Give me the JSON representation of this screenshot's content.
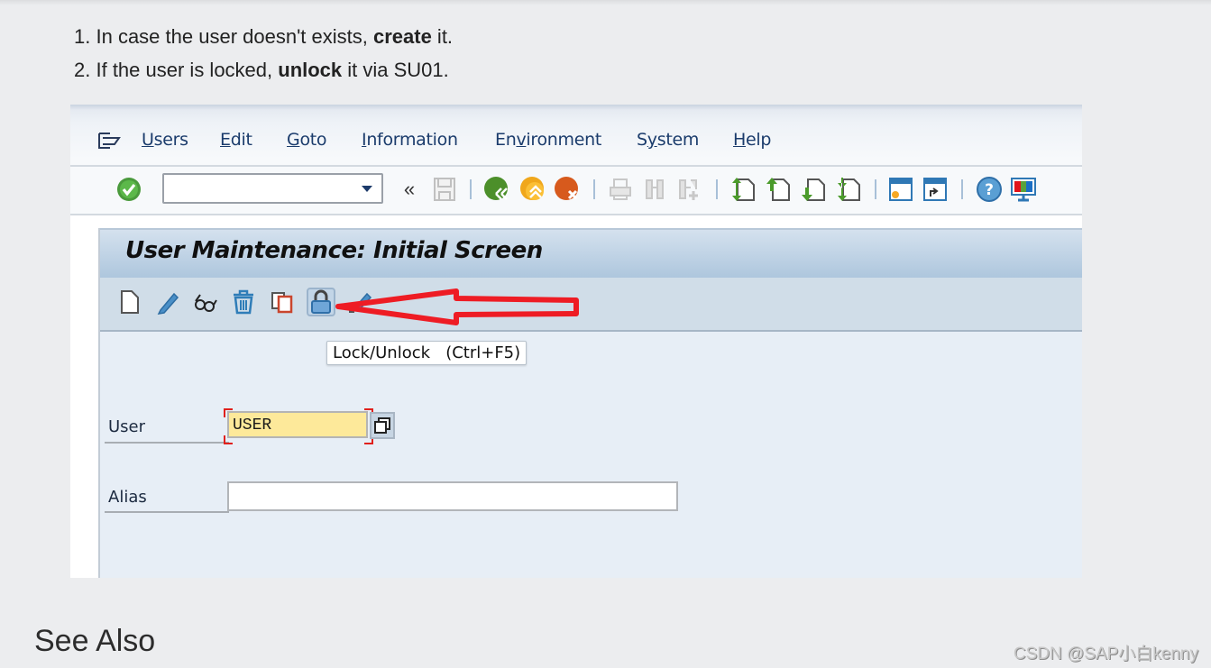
{
  "instructions": {
    "steps": [
      {
        "number": "1.",
        "before": "In case the user doesn't exists, ",
        "bold": "create",
        "after": " it."
      },
      {
        "number": "2.",
        "before": "If the user is locked, ",
        "bold": "unlock",
        "after": " it via SU01."
      }
    ]
  },
  "sap": {
    "menubar": {
      "items": [
        {
          "mnemonic": "U",
          "rest": "sers"
        },
        {
          "mnemonic": "E",
          "rest": "dit"
        },
        {
          "mnemonic": "G",
          "rest": "oto"
        },
        {
          "mnemonic": "I",
          "rest": "nformation"
        },
        {
          "pre": "En",
          "mnemonic": "v",
          "rest": "ironment"
        },
        {
          "pre": "S",
          "mnemonic": "y",
          "rest": "stem"
        },
        {
          "mnemonic": "H",
          "rest": "elp"
        }
      ]
    },
    "toolbar": {
      "command_field_value": "",
      "icons": [
        "enter-icon",
        "collapse-icon",
        "save-icon",
        "back-icon",
        "exit-icon",
        "cancel-icon",
        "print-icon",
        "find-icon",
        "find-next-icon",
        "first-page-icon",
        "previous-page-icon",
        "next-page-icon",
        "last-page-icon",
        "create-session-icon",
        "shortcut-icon",
        "help-icon",
        "layout-menu-icon"
      ]
    },
    "screen_title": "User Maintenance: Initial Screen",
    "app_toolbar": {
      "icons": [
        "create-icon",
        "change-icon",
        "display-icon",
        "delete-icon",
        "copy-icon",
        "lock-unlock-icon",
        "change-password-icon"
      ]
    },
    "tooltip": "Lock/Unlock   (Ctrl+F5)",
    "fields": {
      "user_label": "User",
      "user_value": "USER",
      "alias_label": "Alias",
      "alias_value": ""
    },
    "annotation": {
      "color": "#ee1c24",
      "points_to": "lock-unlock-icon"
    }
  },
  "footer": {
    "heading": "See Also",
    "watermark": "CSDN @SAP小白kenny"
  }
}
